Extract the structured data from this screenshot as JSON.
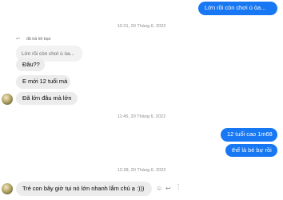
{
  "messages": {
    "out_1": "Lớn rồi còn chơi ú òa...",
    "timestamp_1": "10:31, 20 Tháng 6, 2022",
    "reply_label": "đã trả lời bạn",
    "quoted": "Lớn rồi còn chơi ú òa...",
    "in_1": "Đâu??",
    "in_2": "E mới 12 tuổi mà",
    "in_3": "Đã lớn đâu mà lớn",
    "timestamp_2": "11:45, 20 Tháng 6, 2022",
    "out_2": "12 tuổi cao 1m68",
    "out_3": "thế là bé bự rồi",
    "timestamp_3": "12:38, 20 Tháng 6, 2022",
    "in_4": "Trẻ con bây giờ tụi nó lớn nhanh lắm chú ạ :)))"
  },
  "icons": {
    "reply": "reply-arrow-icon",
    "emoji": "smiley-icon",
    "share": "reply-icon",
    "more": "more-icon"
  },
  "colors": {
    "outgoing": "#1877f2",
    "incoming": "#ececec",
    "timestamp": "#8a8d91"
  }
}
